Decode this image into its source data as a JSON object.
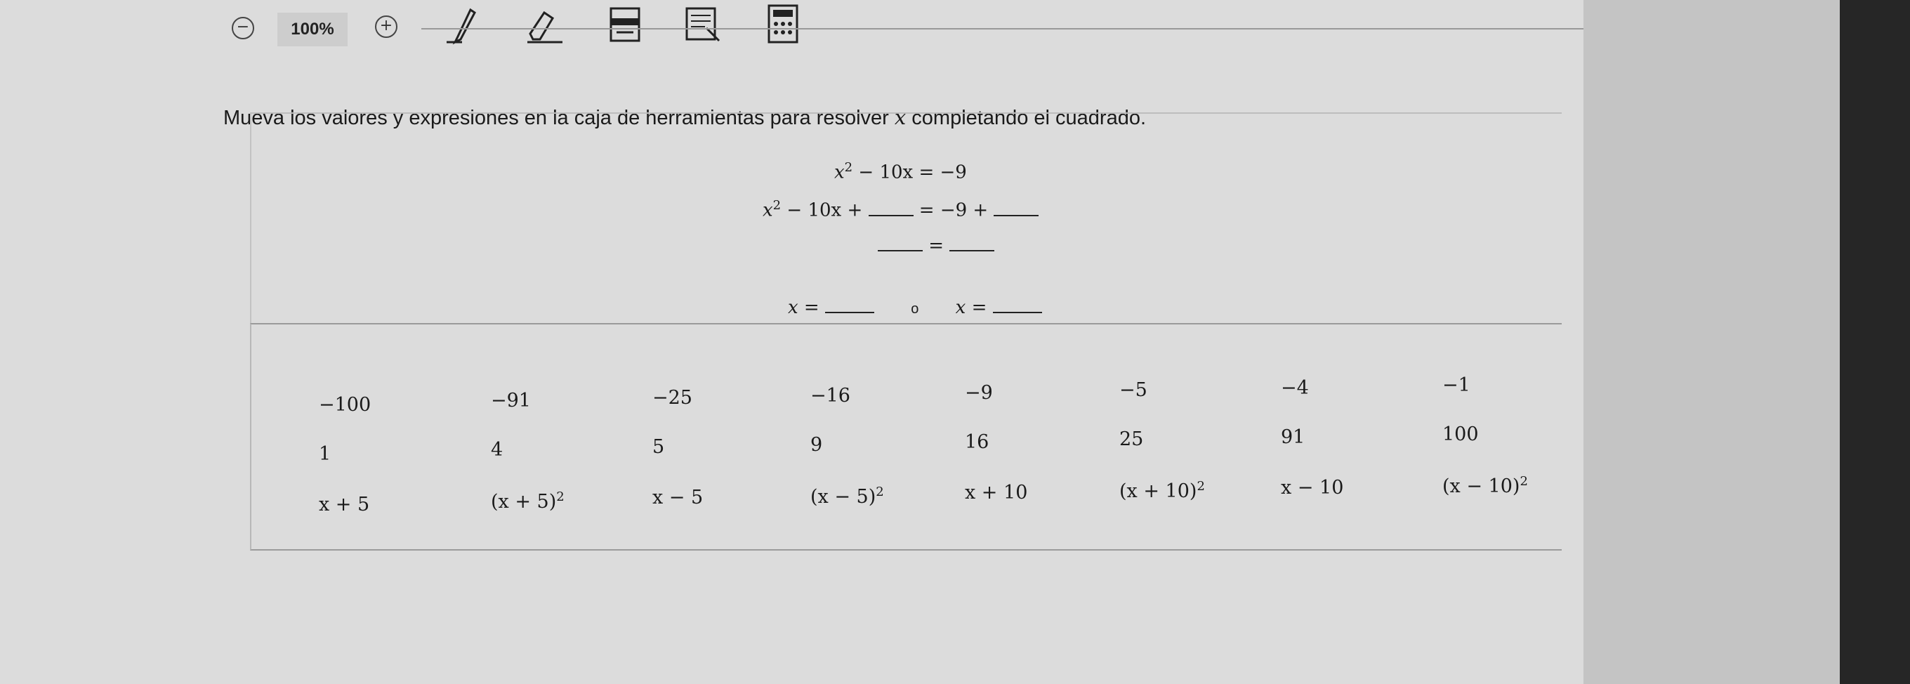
{
  "toolbar": {
    "zoom_out_symbol": "−",
    "zoom_level": "100%",
    "zoom_in_symbol": "+"
  },
  "instruction": {
    "before": "Mueva los valores y expresiones en la caja de herramientas para resolver ",
    "variable": "x",
    "after": " completando el cuadrado."
  },
  "equations": {
    "line1": {
      "base": "x",
      "exp": "2",
      "rest": " − 10x = −9"
    },
    "line2": {
      "base": "x",
      "exp": "2",
      "left": " − 10x +",
      "mid": " = −9 +"
    },
    "line3": {
      "eq": "="
    },
    "line4": {
      "x_left": "x =",
      "connector": "o",
      "x_right": "x ="
    }
  },
  "tiles": [
    [
      {
        "t": "−100"
      },
      {
        "t": "−91"
      },
      {
        "t": "−25"
      },
      {
        "t": "−16"
      },
      {
        "t": "−9"
      },
      {
        "t": "−5"
      },
      {
        "t": "−4"
      },
      {
        "t": "−1"
      }
    ],
    [
      {
        "t": "1"
      },
      {
        "t": "4"
      },
      {
        "t": "5"
      },
      {
        "t": "9"
      },
      {
        "t": "16"
      },
      {
        "t": "25"
      },
      {
        "t": "91"
      },
      {
        "t": "100"
      }
    ],
    [
      {
        "t": "x + 5"
      },
      {
        "t": "(x + 5)",
        "sup": "2"
      },
      {
        "t": "x − 5"
      },
      {
        "t": "(x − 5)",
        "sup": "2"
      },
      {
        "t": "x + 10"
      },
      {
        "t": "(x + 10)",
        "sup": "2"
      },
      {
        "t": "x − 10"
      },
      {
        "t": "(x − 10)",
        "sup": "2"
      }
    ]
  ]
}
